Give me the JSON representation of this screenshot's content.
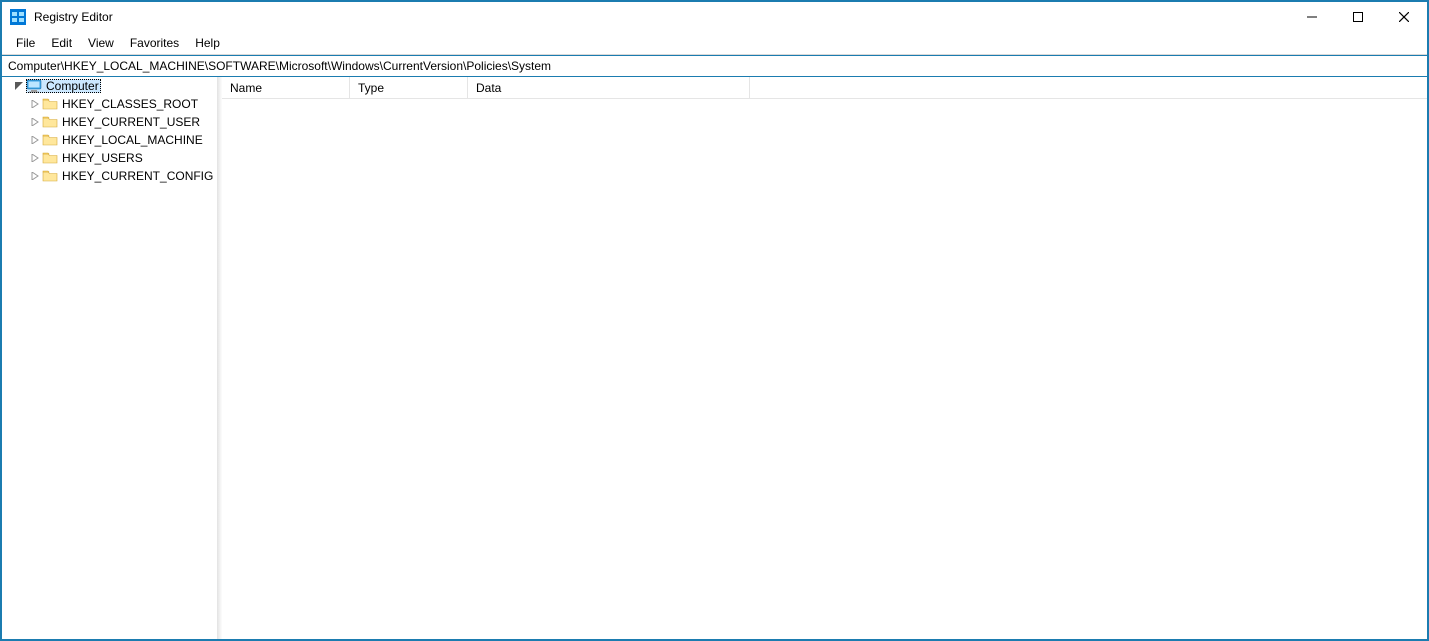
{
  "window": {
    "title": "Registry Editor"
  },
  "menu": {
    "items": [
      "File",
      "Edit",
      "View",
      "Favorites",
      "Help"
    ]
  },
  "address": {
    "path": "Computer\\HKEY_LOCAL_MACHINE\\SOFTWARE\\Microsoft\\Windows\\CurrentVersion\\Policies\\System"
  },
  "tree": {
    "root": "Computer",
    "hives": [
      "HKEY_CLASSES_ROOT",
      "HKEY_CURRENT_USER",
      "HKEY_LOCAL_MACHINE",
      "HKEY_USERS",
      "HKEY_CURRENT_CONFIG"
    ]
  },
  "list": {
    "columns": {
      "name": "Name",
      "type": "Type",
      "data": "Data"
    }
  }
}
